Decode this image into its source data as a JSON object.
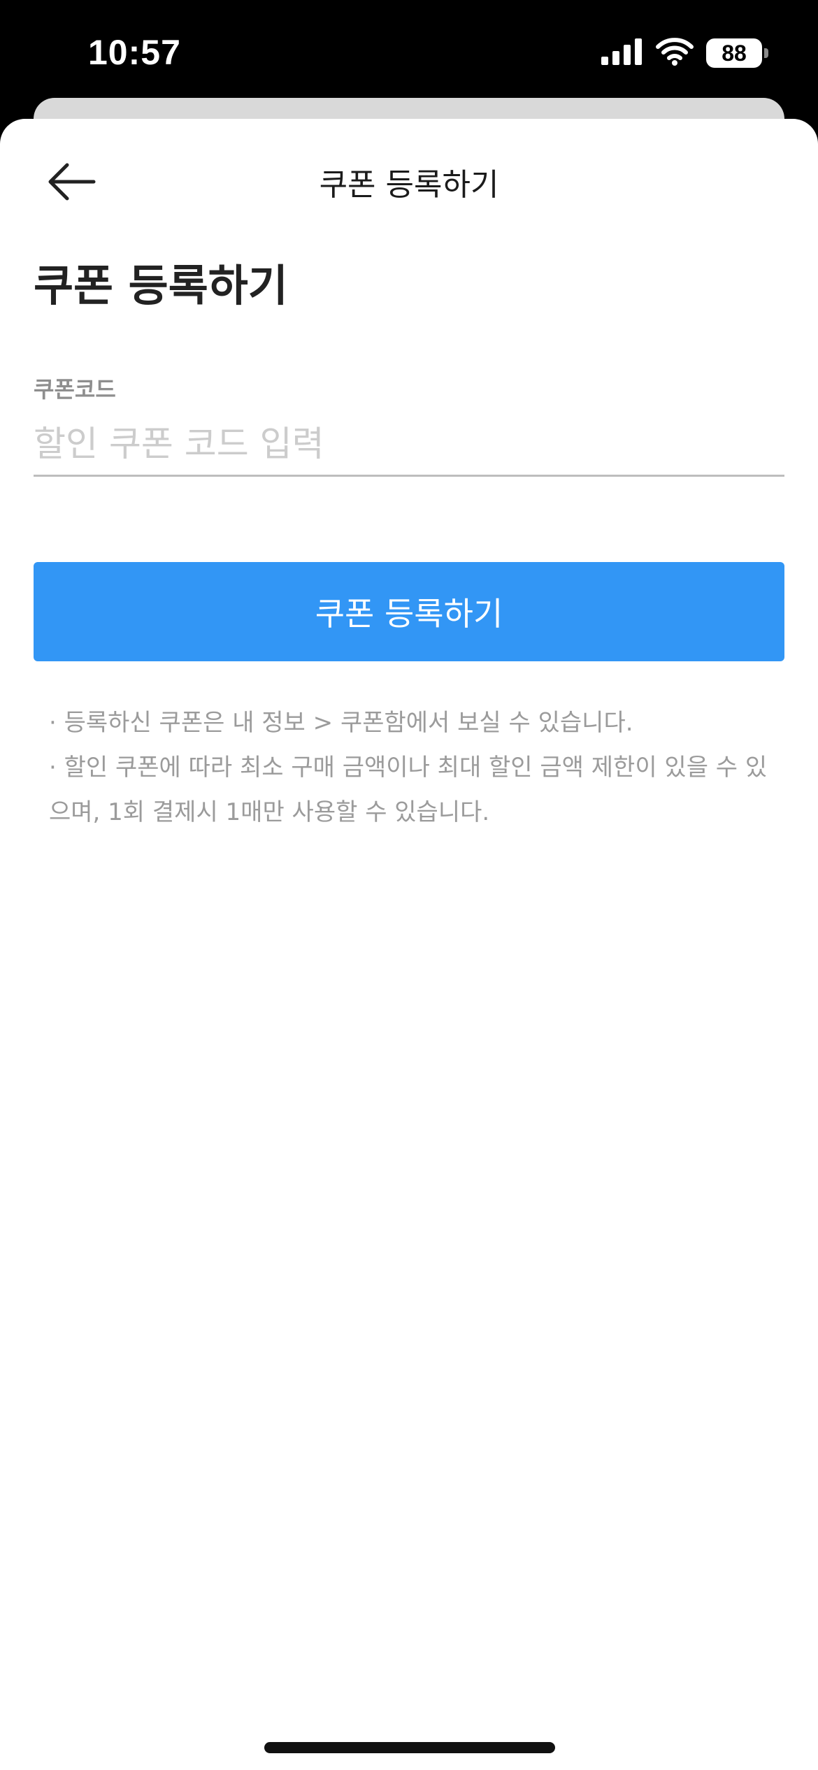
{
  "status_bar": {
    "time": "10:57",
    "battery_level": "88"
  },
  "header": {
    "back_icon": "arrow-left-icon",
    "title": "쿠폰 등록하기"
  },
  "main": {
    "heading": "쿠폰 등록하기",
    "coupon_field": {
      "label": "쿠폰코드",
      "value": "",
      "placeholder": "할인 쿠폰 코드 입력"
    },
    "submit_label": "쿠폰 등록하기",
    "notes": [
      "· 등록하신 쿠폰은 내 정보 > 쿠폰함에서 보실 수 있습니다.",
      "· 할인 쿠폰에 따라 최소 구매 금액이나 최대 할인 금액 제한이 있을 수 있으며, 1회 결제시 1매만 사용할 수 있습니다."
    ]
  },
  "colors": {
    "accent": "#3296f5",
    "label_gray": "#8e8e8e",
    "note_gray": "#9b9b9b",
    "placeholder_gray": "#cccccc"
  }
}
